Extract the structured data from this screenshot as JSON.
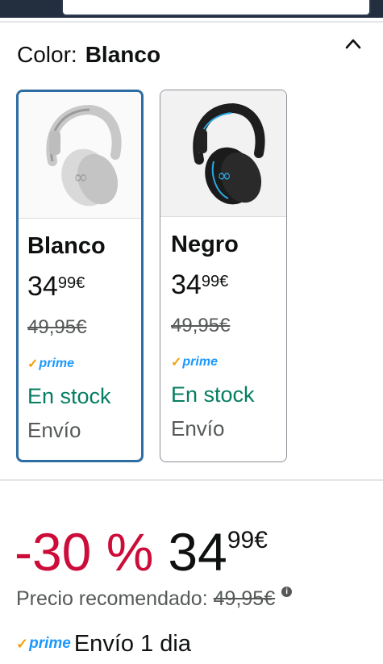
{
  "color_selector": {
    "label": "Color:",
    "selected": "Blanco",
    "options": [
      {
        "name": "Blanco",
        "price_whole": "34",
        "price_fraction": "99",
        "currency": "€",
        "list_price": "49,95€",
        "prime_check": "✓",
        "prime_label": "prime",
        "availability": "En stock",
        "shipping": "Envío",
        "image_icon": "headphones-white-icon"
      },
      {
        "name": "Negro",
        "price_whole": "34",
        "price_fraction": "99",
        "currency": "€",
        "list_price": "49,95€",
        "prime_check": "✓",
        "prime_label": "prime",
        "availability": "En stock",
        "shipping": "Envío",
        "image_icon": "headphones-black-icon"
      }
    ]
  },
  "price_block": {
    "discount": "-30 %",
    "price_whole": "34",
    "price_fraction": "99",
    "currency": "€",
    "recommended_label": "Precio recomendado:",
    "recommended_price": "49,95€",
    "info_icon": "i"
  },
  "delivery": {
    "prime_check": "✓",
    "prime_label": "prime",
    "text": "Envío 1 dia"
  },
  "colors": {
    "selected_border": "#2e6da4",
    "discount_red": "#cc0c39",
    "stock_green": "#067d62",
    "prime_blue": "#1a98ff",
    "prime_check_orange": "#f0a30a"
  }
}
